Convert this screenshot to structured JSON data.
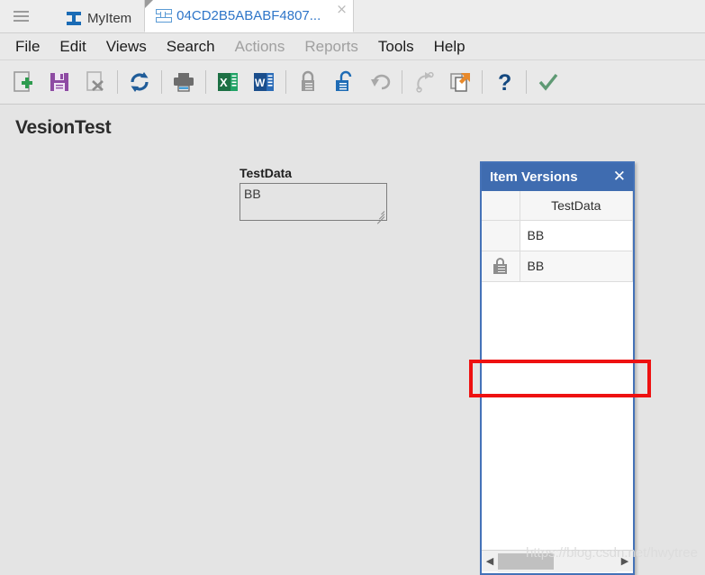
{
  "tabbar": {
    "menu_icon": "hamburger-icon",
    "tabs": [
      {
        "label": "MyItem",
        "icon": "ibeam-icon",
        "active": false
      },
      {
        "label": "04CD2B5ABABF4807...",
        "icon": "ibeam-icon",
        "active": true,
        "close": "×"
      }
    ]
  },
  "menubar": {
    "items": [
      {
        "label": "File",
        "disabled": false
      },
      {
        "label": "Edit",
        "disabled": false
      },
      {
        "label": "Views",
        "disabled": false
      },
      {
        "label": "Search",
        "disabled": false
      },
      {
        "label": "Actions",
        "disabled": true
      },
      {
        "label": "Reports",
        "disabled": true
      },
      {
        "label": "Tools",
        "disabled": false
      },
      {
        "label": "Help",
        "disabled": false
      }
    ]
  },
  "toolbar": {
    "buttons": [
      {
        "name": "new-icon",
        "title": "New"
      },
      {
        "name": "save-icon",
        "title": "Save"
      },
      {
        "name": "delete-icon",
        "title": "Delete"
      },
      {
        "name": "refresh-icon",
        "title": "Refresh"
      },
      {
        "name": "print-icon",
        "title": "Print"
      },
      {
        "name": "excel-export-icon",
        "title": "Export to Excel"
      },
      {
        "name": "word-export-icon",
        "title": "Export to Word"
      },
      {
        "name": "lock-icon",
        "title": "Check In"
      },
      {
        "name": "unlock-icon",
        "title": "Check Out"
      },
      {
        "name": "undo-icon",
        "title": "Undo"
      },
      {
        "name": "redo-icon",
        "title": "Redo"
      },
      {
        "name": "copy-move-icon",
        "title": "Copy"
      },
      {
        "name": "help-icon",
        "title": "Help"
      },
      {
        "name": "confirm-icon",
        "title": "Confirm"
      }
    ]
  },
  "page": {
    "title": "VesionTest"
  },
  "form": {
    "field_label": "TestData",
    "field_value": "BB"
  },
  "versions_panel": {
    "title": "Item Versions",
    "close_label": "✕",
    "columns": [
      "",
      "TestData"
    ],
    "rows": [
      {
        "lock": false,
        "value": "BB"
      },
      {
        "lock": true,
        "value": "BB"
      }
    ],
    "scrollbar": {
      "left_arrow": "◀",
      "right_arrow": "▶"
    }
  },
  "annotation": {
    "color": "#ee1111",
    "target": "locked-version-row"
  },
  "watermark": {
    "text": "https://blog.csdn.net/hwytree"
  },
  "colors": {
    "panel_header": "#3f6cb0",
    "panel_border": "#4472b8",
    "window_bg": "#e4e4e4",
    "tab_active_text": "#2e75c8",
    "annotation": "#ee1111"
  }
}
